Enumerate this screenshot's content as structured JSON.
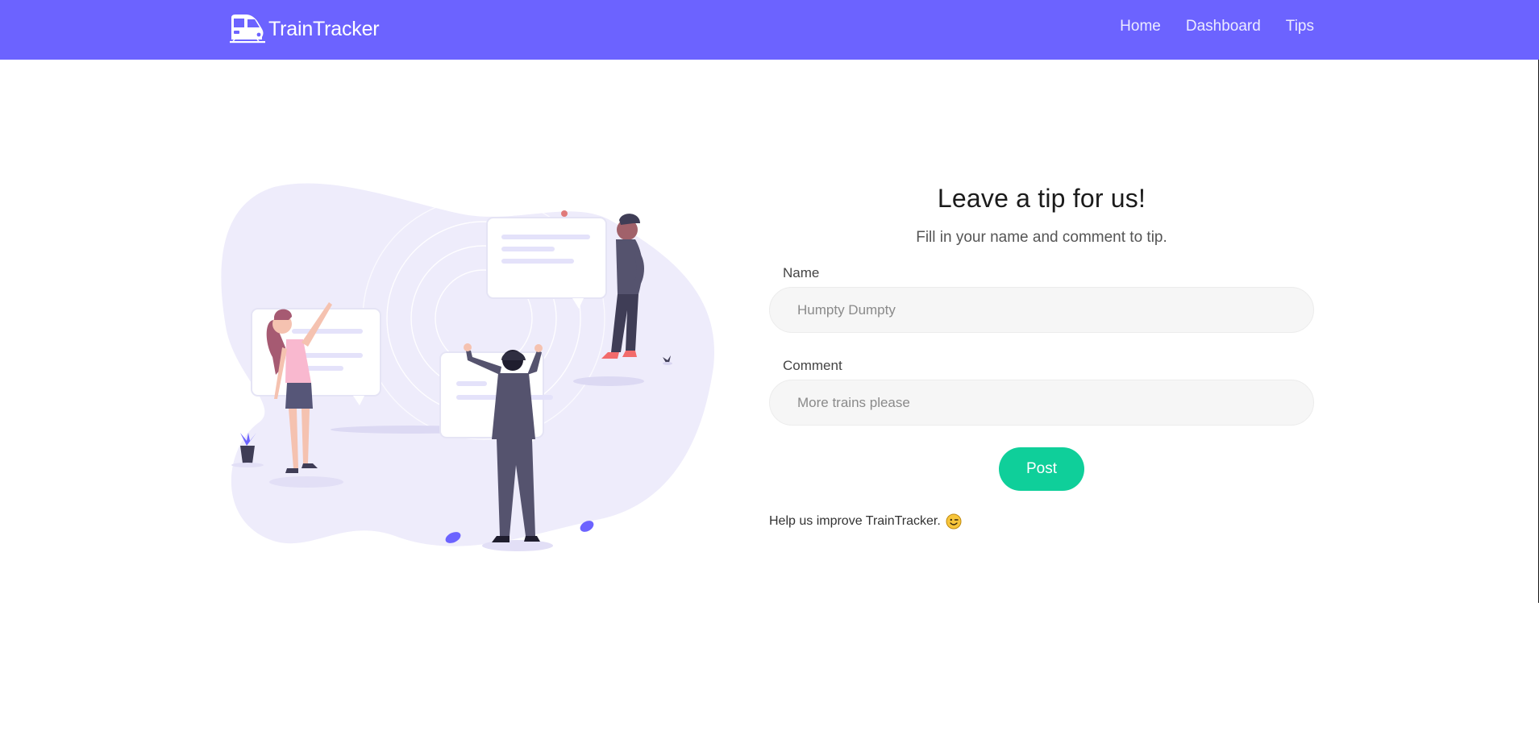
{
  "navbar": {
    "brand": "TrainTracker",
    "brand_icon": "train-icon",
    "links": [
      "Home",
      "Dashboard",
      "Tips"
    ],
    "background_color": "#6c63ff"
  },
  "tip_form": {
    "title": "Leave a tip for us!",
    "subtitle": "Fill in your name and comment to tip.",
    "name_label": "Name",
    "name_placeholder": "Humpty Dumpty",
    "name_value": "",
    "comment_label": "Comment",
    "comment_placeholder": "More trains please",
    "comment_value": "",
    "post_label": "Post",
    "post_color": "#0fcf9a"
  },
  "help_text": "Help us improve TrainTracker.",
  "help_icon": "winking-face-icon",
  "illustration": "people-posting-notes-illustration"
}
